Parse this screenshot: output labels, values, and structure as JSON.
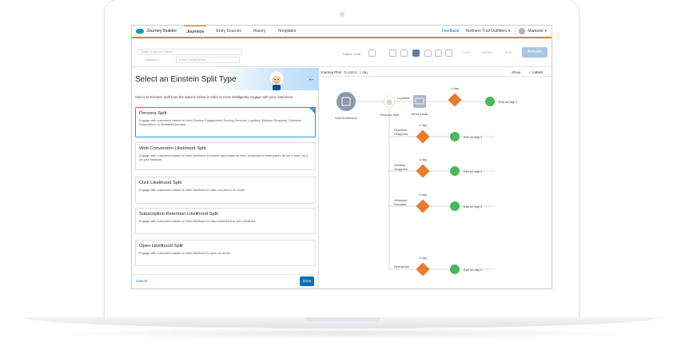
{
  "app": {
    "name": "Journey Builder"
  },
  "nav": {
    "tabs": [
      "Journeys",
      "Entry Sources",
      "History",
      "Templates"
    ],
    "feedback": "Feedback",
    "org": "Northern Trail Outfitters ▾",
    "user": "Marketer ▾"
  },
  "toolbar": {
    "journey_name_placeholder": "Enter a journey Name",
    "version": "Version 1",
    "description_placeholder": "Enter a description...",
    "status": "Status: Draft",
    "save": "Save",
    "validate": "Validate",
    "test": "Test",
    "activate": "Activate"
  },
  "panel": {
    "title": "Select an Einstein Split Type",
    "intro": "Select an Einstein Split from the options below in order to more intelligently engage with your customers.",
    "cards": [
      {
        "title": "Persona Split",
        "desc": "Engage with customers based on their Einstein Engagement Scoring Persona: Loyalists, Window Shoppers, Selective Subscribers, or Winback/Dormant."
      },
      {
        "title": "Web Conversion Likelihood Split",
        "desc": "Engage with customers based on their likelihood to convert (purchase an item, download a white paper, fill out a form, etc.) on your Website."
      },
      {
        "title": "Click Likelihood Split",
        "desc": "Engage with customers based on their likelihood to click on a link in an email."
      },
      {
        "title": "Subscription Retention Likelihood Split",
        "desc": "Engage with customers based on their likelihood to stay subscribed to your email list."
      },
      {
        "title": "Open Likelihood Split",
        "desc": "Engage with customers based on their likelihood to open an email."
      }
    ],
    "cancel": "Cancel",
    "done": "Done"
  },
  "plan": {
    "title": "Journey Plan",
    "duration": "Duration: 1 day",
    "show": "Show",
    "labels": "Labels",
    "nodes": {
      "data_extension": "Data Extension",
      "persona_split": "Persona Split",
      "send_email": "Send Email",
      "loyalists": "Loyalists",
      "selective": "Selective Shoppers",
      "window": "Window Shoppers",
      "winback": "Winback/ Dormant",
      "remainder": "Remainder",
      "one_day": "1 day",
      "exit": "Exit on day 1"
    }
  },
  "colors": {
    "accent_orange": "#e87b27",
    "brand_blue": "#0b6fbf",
    "wait_orange": "#ea7a2c",
    "exit_green": "#4bb85f",
    "entry_gray": "#8b9aaa"
  }
}
